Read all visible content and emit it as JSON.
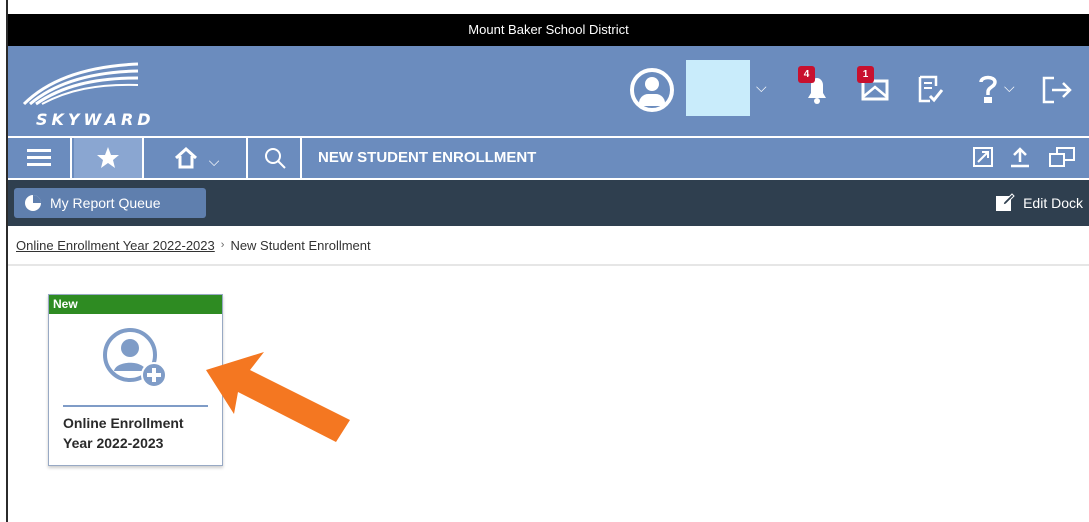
{
  "district_bar": {
    "title": "Mount Baker School District"
  },
  "header": {
    "logo_text": "SKYWARD",
    "notifications_count": "4",
    "messages_count": "1"
  },
  "toolbar": {
    "page_title": "NEW STUDENT ENROLLMENT"
  },
  "dock": {
    "report_queue_label": "My Report Queue",
    "edit_dock_label": "Edit Dock"
  },
  "breadcrumb": {
    "parent": "Online Enrollment Year 2022-2023",
    "current": "New Student Enrollment"
  },
  "tile": {
    "flag": "New",
    "label_line1": "Online Enrollment",
    "label_line2": "Year 2022-2023"
  },
  "colors": {
    "header_blue": "#6b8cbe",
    "dock_dark": "#2f3f4f",
    "new_green": "#2e8b22",
    "badge_red": "#c8102e",
    "arrow_orange": "#f47721"
  },
  "icons": [
    "profile-icon",
    "chevron-down-icon",
    "bell-icon",
    "mail-icon",
    "checklist-icon",
    "help-icon",
    "logout-icon",
    "hamburger-icon",
    "star-icon",
    "home-icon",
    "search-icon",
    "resize-icon",
    "upload-icon",
    "windows-icon",
    "pie-chart-icon",
    "edit-icon",
    "add-user-icon",
    "arrow-annotation"
  ]
}
